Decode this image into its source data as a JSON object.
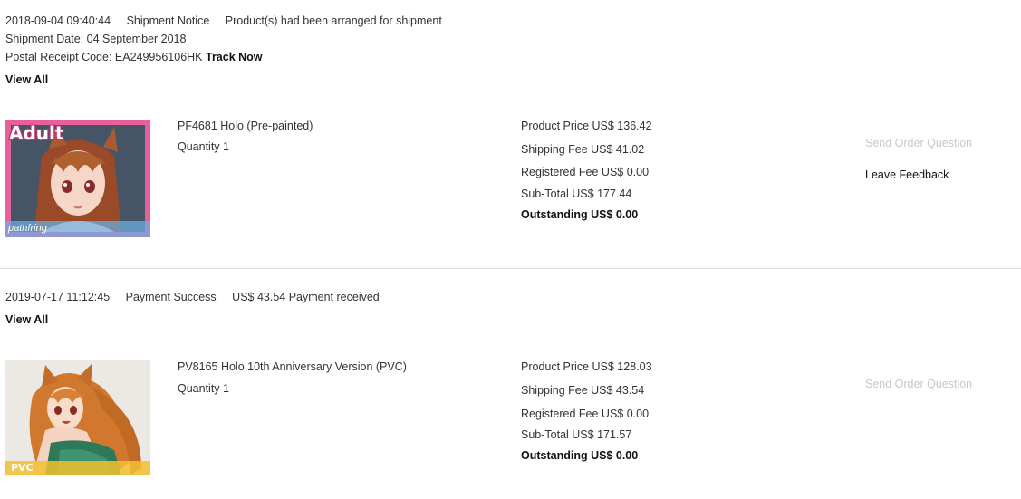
{
  "orders": [
    {
      "datetime": "2018-09-04 09:40:44",
      "status": "Shipment Notice",
      "message": "Product(s) had been arranged for shipment",
      "shipment_date": "Shipment Date: 04 September 2018",
      "postal_code": "Postal Receipt Code: EA249956106HK",
      "track_label": "Track Now",
      "view_all": "View All",
      "product_name": "PF4681 Holo (Pre-painted)",
      "quantity": "Quantity 1",
      "badge": "Adult",
      "watermark": "pathfring",
      "product_price": "Product Price US$ 136.42",
      "shipping_fee": "Shipping Fee US$ 41.02",
      "registered_fee": "Registered Fee US$ 0.00",
      "subtotal": "Sub-Total US$ 177.44",
      "outstanding": "Outstanding US$ 0.00",
      "send_question": "Send Order Question",
      "leave_feedback": "Leave Feedback"
    },
    {
      "datetime": "2019-07-17 11:12:45",
      "status": "Payment Success",
      "message": "US$ 43.54 Payment received",
      "view_all": "View All",
      "product_name": "PV8165 Holo 10th Anniversary Version (PVC)",
      "quantity": "Quantity 1",
      "badge": "PVC",
      "product_price": "Product Price US$ 128.03",
      "shipping_fee": "Shipping Fee US$ 43.54",
      "registered_fee": "Registered Fee US$ 0.00",
      "subtotal": "Sub-Total US$ 171.57",
      "outstanding": "Outstanding US$ 0.00",
      "send_question": "Send Order Question"
    }
  ],
  "colors": {
    "text": "#333333",
    "emphasis": "#111111",
    "disabled": "#c8c8c8",
    "adult_badge": "#e85b8e",
    "pvc_badge": "#f0b020"
  }
}
